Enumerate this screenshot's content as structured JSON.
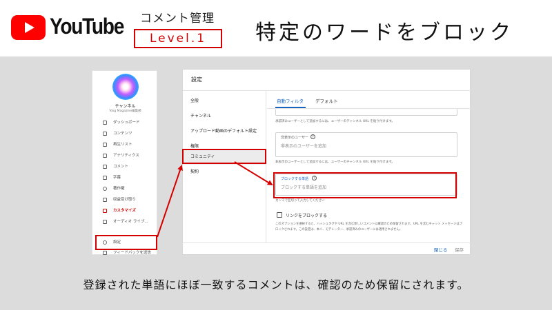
{
  "header": {
    "brand": "YouTube",
    "category": "コメント管理",
    "level": "Level.1",
    "title": "特定のワードをブロック"
  },
  "sidebar": {
    "channel_name": "チャンネル",
    "channel_sub": "Vlog Magazine編集部",
    "items": [
      {
        "label": "ダッシュボード",
        "icon": "dashboard-icon"
      },
      {
        "label": "コンテンツ",
        "icon": "content-icon"
      },
      {
        "label": "再生リスト",
        "icon": "playlist-icon"
      },
      {
        "label": "アナリティクス",
        "icon": "analytics-icon"
      },
      {
        "label": "コメント",
        "icon": "comment-icon"
      },
      {
        "label": "字幕",
        "icon": "subtitles-icon"
      },
      {
        "label": "著作権",
        "icon": "copyright-icon"
      },
      {
        "label": "収益受け取り",
        "icon": "dollar-icon"
      },
      {
        "label": "カスタマイズ",
        "icon": "customize-icon"
      },
      {
        "label": "オーディオ ライブ...",
        "icon": "audio-library-icon"
      },
      {
        "label": "設定",
        "icon": "gear-icon"
      },
      {
        "label": "フィードバックを送信",
        "icon": "feedback-icon"
      }
    ]
  },
  "dialog": {
    "title": "設定",
    "nav": [
      "全般",
      "チャンネル",
      "アップロード動画のデフォルト設定",
      "権限",
      "コミュニティ",
      "契約"
    ],
    "tabs": [
      "自動フィルタ",
      "デフォルト"
    ],
    "hint_top": "承認済みユーザーとして追加するには、ユーザーのチャンネル URL を貼り付けます。",
    "hidden_users": {
      "label": "非表示のユーザー",
      "placeholder": "非表示のユーザーを追加",
      "hint": "非表示のユーザーとして追加するには、ユーザーのチャンネル URL を貼り付けます。"
    },
    "blocked_words": {
      "label": "ブロックする単語",
      "placeholder": "ブロックする単語を追加",
      "hint": "カンマで区切って入力してください"
    },
    "block_links": {
      "label": "リンクをブロックする",
      "description": "このオプションを選択すると、ハッシュタグや URL を含む新しいコメントは確認のため保留されます。URL を含むチャット メッセージはブロックされます。この設定は、本人、モデレーター、承認済みのユーザーには適用されません。"
    },
    "close_label": "閉じる",
    "save_label": "保存"
  },
  "caption": "登録された単語にほぼ一致するコメントは、確認のため保留にされます。",
  "colors": {
    "accent_red": "#d40000",
    "link_blue": "#1565c0",
    "background": "#dcdcdc"
  }
}
